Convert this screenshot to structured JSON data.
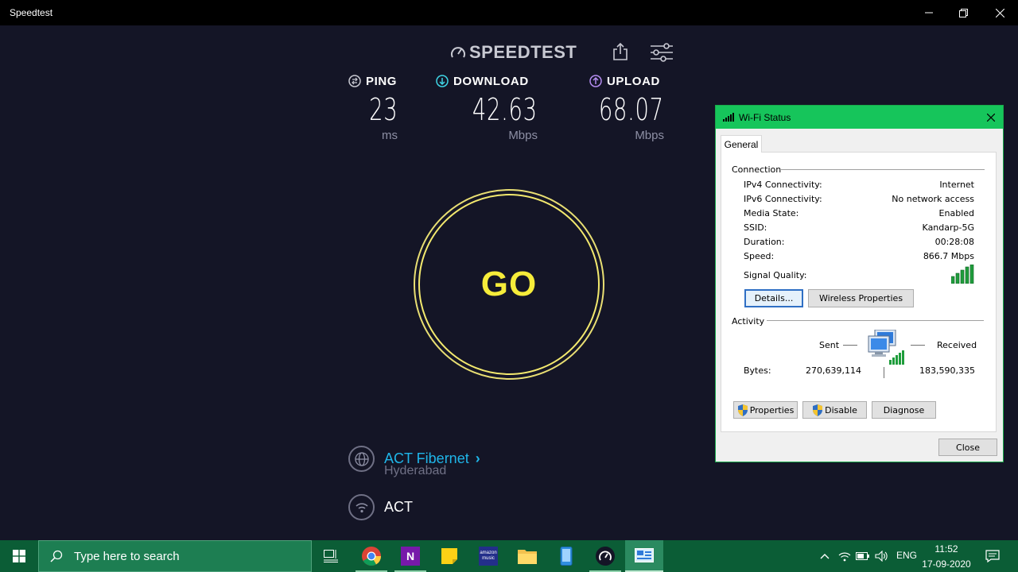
{
  "window": {
    "title": "Speedtest"
  },
  "speedtest": {
    "logo_text": "SPEEDTEST",
    "ping": {
      "label": "PING",
      "value": "23",
      "unit": "ms"
    },
    "download": {
      "label": "DOWNLOAD",
      "value": "42.63",
      "unit": "Mbps"
    },
    "upload": {
      "label": "UPLOAD",
      "value": "68.07",
      "unit": "Mbps"
    },
    "go_label": "GO",
    "server": {
      "name": "ACT Fibernet",
      "chevron": "›",
      "location": "Hyderabad"
    },
    "network": {
      "name": "ACT"
    },
    "colors": {
      "background": "#141526",
      "go_ring": "#e8de73",
      "go_text": "#f6ec3a",
      "isp_link": "#1fb6e9",
      "download_icon": "#3fd5e5",
      "upload_icon": "#b48cf0"
    }
  },
  "wifi_status": {
    "title": "Wi-Fi Status",
    "tab": "General",
    "connection_heading": "Connection",
    "rows": [
      {
        "label": "IPv4 Connectivity:",
        "value": "Internet"
      },
      {
        "label": "IPv6 Connectivity:",
        "value": "No network access"
      },
      {
        "label": "Media State:",
        "value": "Enabled"
      },
      {
        "label": "SSID:",
        "value": "Kandarp-5G"
      },
      {
        "label": "Duration:",
        "value": "00:28:08"
      },
      {
        "label": "Speed:",
        "value": "866.7 Mbps"
      }
    ],
    "signal_quality_label": "Signal Quality:",
    "signal_bars": 5,
    "details_button": "Details...",
    "wireless_properties_button": "Wireless Properties",
    "activity_heading": "Activity",
    "sent_label": "Sent",
    "received_label": "Received",
    "bytes_label": "Bytes:",
    "bytes_sent": "270,639,114",
    "bytes_received": "183,590,335",
    "properties_button": "Properties",
    "disable_button": "Disable",
    "diagnose_button": "Diagnose",
    "close_button": "Close",
    "colors": {
      "titlebar": "#16c55b"
    }
  },
  "taskbar": {
    "search_placeholder": "Type here to search",
    "apps": [
      "chrome-icon",
      "onenote-icon",
      "sticky-notes-icon",
      "amazon-music-icon",
      "file-explorer-icon",
      "phone-icon",
      "speedtest-icon",
      "network-settings-icon"
    ],
    "amazon_music_text": "amazon music",
    "language": "ENG",
    "time": "11:52",
    "date": "17-09-2020",
    "colors": {
      "background": "#0b5d36"
    }
  }
}
